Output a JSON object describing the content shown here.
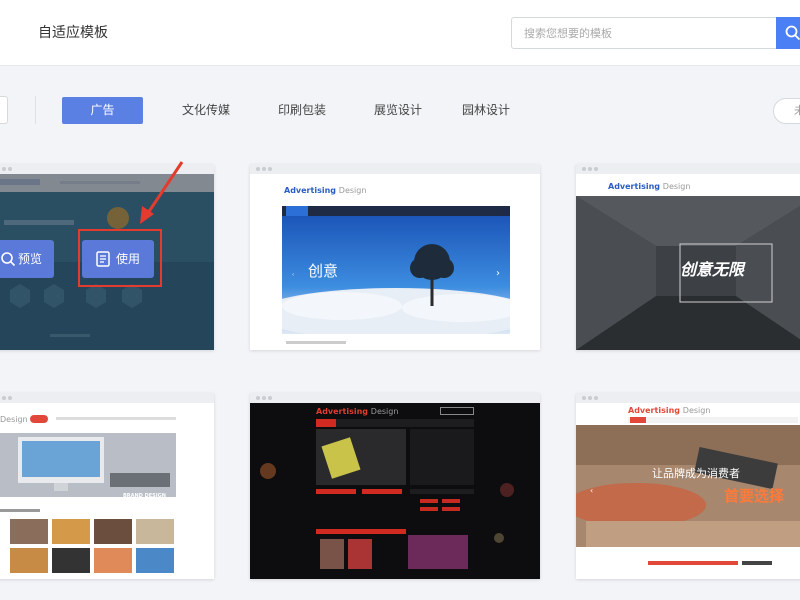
{
  "header": {
    "title": "自适应模板",
    "search_placeholder": "搜索您想要的模板"
  },
  "categories": {
    "items": [
      "广告",
      "文化传媒",
      "印刷包装",
      "展览设计",
      "园林设计"
    ],
    "active_index": 0,
    "more_label": "未"
  },
  "cards": {
    "card1": {
      "preview_label": "预览",
      "use_label": "使用"
    },
    "card2": {
      "brand": "Advertising",
      "brand_sub": "Design",
      "hero_text": "创意"
    },
    "card3": {
      "brand": "Advertising",
      "brand_sub": "Design",
      "hero_text": "创意无限"
    },
    "card4": {
      "brand_sub": "Design",
      "banner_text": "BRAND DESIGN"
    },
    "card5": {
      "brand": "Advertising",
      "brand_sub": "Design"
    },
    "card6": {
      "brand": "Advertising",
      "brand_sub": "Design",
      "hero_line1": "让品牌成为消费者",
      "hero_line2": "首要选择"
    }
  },
  "colors": {
    "accent": "#5b80e3",
    "search_button": "#4a7ff5",
    "highlight": "#e33b2e"
  }
}
